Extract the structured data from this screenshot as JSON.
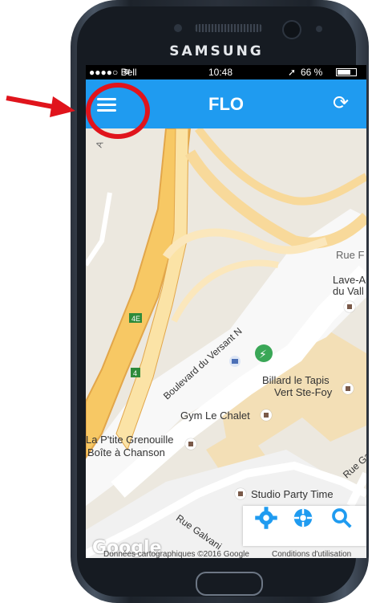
{
  "device": {
    "brand": "SAMSUNG"
  },
  "statusbar": {
    "carrier": "●●●●○ Bell",
    "time": "10:48",
    "battery": "66 %"
  },
  "appbar": {
    "title": "FLO",
    "menu_icon": "menu-icon",
    "refresh_icon": "refresh-icon",
    "color": "#1f9bf0"
  },
  "map": {
    "street_labels": {
      "boulevard": "Boulevard du Versant N",
      "rue_galvani": "Rue Galvani",
      "rue_ga": "Rue Ga",
      "rue_f": "Rue F",
      "a": "A"
    },
    "places": {
      "billard_line1": "Billard le Tapis",
      "billard_line2": "Vert Ste-Foy",
      "gym": "Gym Le Chalet",
      "grenouille_line1": "La P'tite Grenouille",
      "grenouille_line2": "Boîte à Chanson",
      "studio": "Studio Party Time",
      "lave_line1": "Lave-A",
      "lave_line2": "du Vall"
    },
    "route_shields": [
      "4E",
      "4"
    ],
    "footer": {
      "logo": "Google",
      "copyright": "Données cartographiques ©2016 Google",
      "terms": "Conditions d'utilisation"
    }
  },
  "controls": [
    "settings-icon",
    "locate-icon",
    "search-icon"
  ]
}
